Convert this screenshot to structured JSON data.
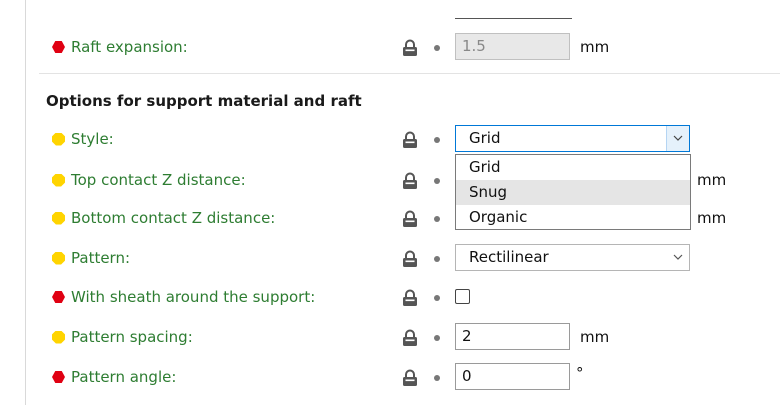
{
  "raft": {
    "raft_expansion": {
      "label": "Raft expansion:",
      "value": "1.5",
      "unit": "mm",
      "disabled": true
    }
  },
  "support": {
    "heading": "Options for support material and raft",
    "style": {
      "label": "Style:",
      "selected": "Grid",
      "options": [
        "Grid",
        "Snug",
        "Organic"
      ],
      "hovered": "Snug"
    },
    "top_contact": {
      "label": "Top contact Z distance:",
      "unit": "mm"
    },
    "bottom_contact": {
      "label": "Bottom contact Z distance:",
      "unit": "mm"
    },
    "pattern": {
      "label": "Pattern:",
      "selected": "Rectilinear"
    },
    "sheath": {
      "label": "With sheath around the support:",
      "checked": false
    },
    "pattern_spacing": {
      "label": "Pattern spacing:",
      "value": "2",
      "unit": "mm"
    },
    "pattern_angle": {
      "label": "Pattern angle:",
      "value": "0",
      "unit": "°"
    }
  },
  "colors": {
    "label_green": "#2e7d32",
    "expert_red": "#e00012",
    "advanced_yellow": "#ffd400",
    "dropdown_focus": "#0078d7"
  },
  "icons": {
    "lock": "lock-icon",
    "bullet": "bullet-icon",
    "caret": "chevron-down-icon",
    "mode_red": "hexagon-icon",
    "mode_yellow": "octagon-icon"
  }
}
